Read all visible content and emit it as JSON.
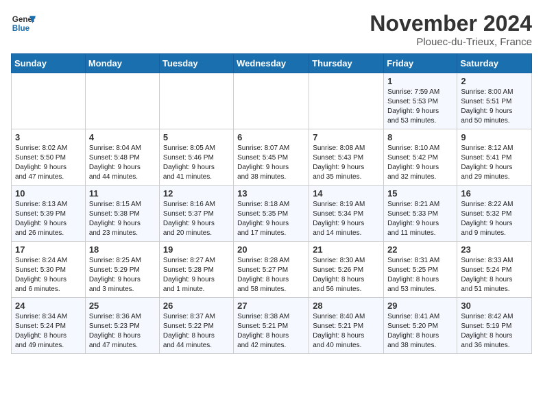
{
  "logo": {
    "line1": "General",
    "line2": "Blue"
  },
  "title": "November 2024",
  "subtitle": "Plouec-du-Trieux, France",
  "days_of_week": [
    "Sunday",
    "Monday",
    "Tuesday",
    "Wednesday",
    "Thursday",
    "Friday",
    "Saturday"
  ],
  "weeks": [
    [
      {
        "day": "",
        "info": ""
      },
      {
        "day": "",
        "info": ""
      },
      {
        "day": "",
        "info": ""
      },
      {
        "day": "",
        "info": ""
      },
      {
        "day": "",
        "info": ""
      },
      {
        "day": "1",
        "info": "Sunrise: 7:59 AM\nSunset: 5:53 PM\nDaylight: 9 hours\nand 53 minutes."
      },
      {
        "day": "2",
        "info": "Sunrise: 8:00 AM\nSunset: 5:51 PM\nDaylight: 9 hours\nand 50 minutes."
      }
    ],
    [
      {
        "day": "3",
        "info": "Sunrise: 8:02 AM\nSunset: 5:50 PM\nDaylight: 9 hours\nand 47 minutes."
      },
      {
        "day": "4",
        "info": "Sunrise: 8:04 AM\nSunset: 5:48 PM\nDaylight: 9 hours\nand 44 minutes."
      },
      {
        "day": "5",
        "info": "Sunrise: 8:05 AM\nSunset: 5:46 PM\nDaylight: 9 hours\nand 41 minutes."
      },
      {
        "day": "6",
        "info": "Sunrise: 8:07 AM\nSunset: 5:45 PM\nDaylight: 9 hours\nand 38 minutes."
      },
      {
        "day": "7",
        "info": "Sunrise: 8:08 AM\nSunset: 5:43 PM\nDaylight: 9 hours\nand 35 minutes."
      },
      {
        "day": "8",
        "info": "Sunrise: 8:10 AM\nSunset: 5:42 PM\nDaylight: 9 hours\nand 32 minutes."
      },
      {
        "day": "9",
        "info": "Sunrise: 8:12 AM\nSunset: 5:41 PM\nDaylight: 9 hours\nand 29 minutes."
      }
    ],
    [
      {
        "day": "10",
        "info": "Sunrise: 8:13 AM\nSunset: 5:39 PM\nDaylight: 9 hours\nand 26 minutes."
      },
      {
        "day": "11",
        "info": "Sunrise: 8:15 AM\nSunset: 5:38 PM\nDaylight: 9 hours\nand 23 minutes."
      },
      {
        "day": "12",
        "info": "Sunrise: 8:16 AM\nSunset: 5:37 PM\nDaylight: 9 hours\nand 20 minutes."
      },
      {
        "day": "13",
        "info": "Sunrise: 8:18 AM\nSunset: 5:35 PM\nDaylight: 9 hours\nand 17 minutes."
      },
      {
        "day": "14",
        "info": "Sunrise: 8:19 AM\nSunset: 5:34 PM\nDaylight: 9 hours\nand 14 minutes."
      },
      {
        "day": "15",
        "info": "Sunrise: 8:21 AM\nSunset: 5:33 PM\nDaylight: 9 hours\nand 11 minutes."
      },
      {
        "day": "16",
        "info": "Sunrise: 8:22 AM\nSunset: 5:32 PM\nDaylight: 9 hours\nand 9 minutes."
      }
    ],
    [
      {
        "day": "17",
        "info": "Sunrise: 8:24 AM\nSunset: 5:30 PM\nDaylight: 9 hours\nand 6 minutes."
      },
      {
        "day": "18",
        "info": "Sunrise: 8:25 AM\nSunset: 5:29 PM\nDaylight: 9 hours\nand 3 minutes."
      },
      {
        "day": "19",
        "info": "Sunrise: 8:27 AM\nSunset: 5:28 PM\nDaylight: 9 hours\nand 1 minute."
      },
      {
        "day": "20",
        "info": "Sunrise: 8:28 AM\nSunset: 5:27 PM\nDaylight: 8 hours\nand 58 minutes."
      },
      {
        "day": "21",
        "info": "Sunrise: 8:30 AM\nSunset: 5:26 PM\nDaylight: 8 hours\nand 56 minutes."
      },
      {
        "day": "22",
        "info": "Sunrise: 8:31 AM\nSunset: 5:25 PM\nDaylight: 8 hours\nand 53 minutes."
      },
      {
        "day": "23",
        "info": "Sunrise: 8:33 AM\nSunset: 5:24 PM\nDaylight: 8 hours\nand 51 minutes."
      }
    ],
    [
      {
        "day": "24",
        "info": "Sunrise: 8:34 AM\nSunset: 5:24 PM\nDaylight: 8 hours\nand 49 minutes."
      },
      {
        "day": "25",
        "info": "Sunrise: 8:36 AM\nSunset: 5:23 PM\nDaylight: 8 hours\nand 47 minutes."
      },
      {
        "day": "26",
        "info": "Sunrise: 8:37 AM\nSunset: 5:22 PM\nDaylight: 8 hours\nand 44 minutes."
      },
      {
        "day": "27",
        "info": "Sunrise: 8:38 AM\nSunset: 5:21 PM\nDaylight: 8 hours\nand 42 minutes."
      },
      {
        "day": "28",
        "info": "Sunrise: 8:40 AM\nSunset: 5:21 PM\nDaylight: 8 hours\nand 40 minutes."
      },
      {
        "day": "29",
        "info": "Sunrise: 8:41 AM\nSunset: 5:20 PM\nDaylight: 8 hours\nand 38 minutes."
      },
      {
        "day": "30",
        "info": "Sunrise: 8:42 AM\nSunset: 5:19 PM\nDaylight: 8 hours\nand 36 minutes."
      }
    ]
  ]
}
